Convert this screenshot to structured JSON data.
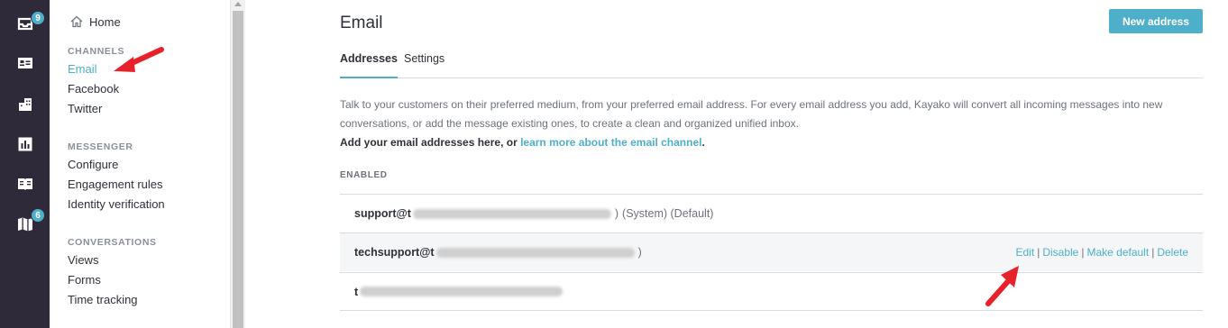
{
  "rail": {
    "badges": [
      "9",
      "6"
    ]
  },
  "sidebar": {
    "home": "Home",
    "sections": [
      {
        "heading": "CHANNELS",
        "items": [
          "Email",
          "Facebook",
          "Twitter"
        ]
      },
      {
        "heading": "MESSENGER",
        "items": [
          "Configure",
          "Engagement rules",
          "Identity verification"
        ]
      },
      {
        "heading": "CONVERSATIONS",
        "items": [
          "Views",
          "Forms",
          "Time tracking"
        ]
      }
    ]
  },
  "main": {
    "title": "Email",
    "new_button": "New address",
    "tabs": [
      "Addresses",
      "Settings"
    ],
    "description": {
      "text": "Talk to your customers on their preferred medium, from your preferred email address. For every email address you add, Kayako will convert all incoming messages into new conversations, or add the message existing ones, to create a clean and organized unified inbox.",
      "cta_prefix": "Add your email addresses here, or ",
      "cta_link": "learn more about the email channel",
      "cta_suffix": "."
    },
    "enabled_label": "ENABLED",
    "addresses": [
      {
        "prefix": "support@t",
        "tail": ")",
        "tags": "(System) (Default)"
      },
      {
        "prefix": "techsupport@t",
        "tail": ")",
        "tags": ""
      },
      {
        "prefix": "t",
        "tail": "",
        "tags": ""
      }
    ],
    "row_actions": [
      "Edit",
      "Disable",
      "Make default",
      "Delete"
    ]
  },
  "colors": {
    "accent": "#4eafcb",
    "rail_bg": "#2f2a3a",
    "annotation_arrow": "#e8222a"
  }
}
